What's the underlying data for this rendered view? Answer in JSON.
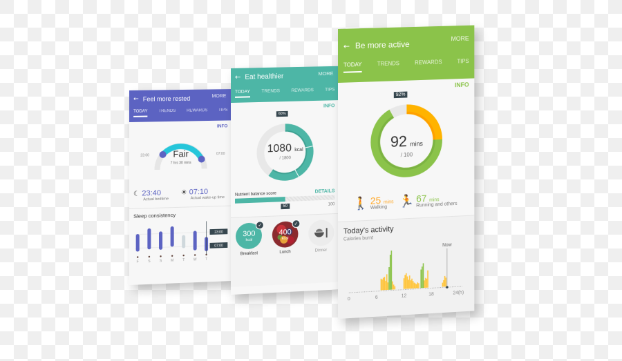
{
  "phones": {
    "sleep": {
      "title": "Feel more rested",
      "more": "MORE",
      "tabs": [
        "TODAY",
        "TRENDS",
        "REWARDS",
        "TIPS"
      ],
      "active_tab": "TODAY",
      "info": "INFO",
      "color": "#5c63c2",
      "gauge": {
        "rating": "Fair",
        "duration": "7 hrs 30 mins",
        "target_start": "23:00",
        "target_end": "07:00",
        "arc_color": "#26c6da"
      },
      "bedtime": {
        "value": "23:40",
        "label": "Actual bedtime",
        "icon": "moon-icon"
      },
      "wakeup": {
        "value": "07:10",
        "label": "Actual wake-up time",
        "icon": "sunrise-icon"
      },
      "consistency": {
        "title": "Sleep consistency",
        "days": [
          "F",
          "S",
          "S",
          "M",
          "T",
          "W",
          "T"
        ],
        "bars": [
          {
            "start": 0.25,
            "end": 0.92,
            "active": true
          },
          {
            "start": 0.05,
            "end": 0.85,
            "active": true
          },
          {
            "start": 0.18,
            "end": 0.88,
            "active": true
          },
          {
            "start": 0.0,
            "end": 0.78,
            "active": true
          },
          {
            "start": 0.35,
            "end": 0.85,
            "active": false
          },
          {
            "start": 0.2,
            "end": 0.95,
            "active": true
          },
          {
            "start": 0.45,
            "end": 1.0,
            "active": true
          }
        ],
        "ref_top": "23:00",
        "ref_bottom": "07:00"
      }
    },
    "eat": {
      "title": "Eat healthier",
      "more": "MORE",
      "tabs": [
        "TODAY",
        "TRENDS",
        "REWARDS",
        "TIPS"
      ],
      "active_tab": "TODAY",
      "info": "INFO",
      "color": "#4db6a6",
      "ring": {
        "percent_label": "60%",
        "progress": 0.6,
        "value": "1080",
        "unit": "kcal",
        "goal": "/ 1800"
      },
      "nutrient": {
        "label": "Nutrient balance score",
        "details": "DETAILS",
        "score": 50,
        "max": 100,
        "score_label": "50",
        "max_label": "100"
      },
      "meals": [
        {
          "name": "Breakfast",
          "value": "300",
          "unit": "kcal",
          "logged": true
        },
        {
          "name": "Lunch",
          "value": "400",
          "unit": "kcal",
          "logged": true
        },
        {
          "name": "Dinner",
          "value": "",
          "unit": "",
          "logged": false
        }
      ]
    },
    "active": {
      "title": "Be more active",
      "more": "MORE",
      "tabs": [
        "TODAY",
        "TRENDS",
        "REWARDS",
        "TIPS"
      ],
      "active_tab": "TODAY",
      "info": "INFO",
      "color": "#8bc34a",
      "ring": {
        "percent_label": "92%",
        "progress": 0.92,
        "value": "92",
        "unit": "mins",
        "goal": "/ 100",
        "walking_share": 0.25,
        "walking_color": "#ffb300",
        "running_color": "#8bc34a"
      },
      "walking": {
        "value": "25",
        "unit": "mins",
        "label": "Walking",
        "color": "#ffa726"
      },
      "running": {
        "value": "67",
        "unit": "mins",
        "label": "Running and others",
        "color": "#8bc34a"
      },
      "activity": {
        "title": "Today's activity",
        "subtitle": "Calories burnt",
        "now_label": "Now",
        "now_hour": 21.5
      }
    }
  },
  "chart_data": {
    "type": "bar",
    "title": "Today's activity",
    "subtitle": "Calories burnt",
    "xlabel": "",
    "ylabel": "",
    "xlim": [
      0,
      24
    ],
    "x_ticks": [
      "0",
      "6",
      "12",
      "18",
      "24(h)"
    ],
    "annotation": {
      "label": "Now",
      "x": 21.5
    },
    "series": [
      {
        "name": "Walking",
        "color": "#ffc53d",
        "x": [
          7.0,
          7.25,
          7.5,
          7.75,
          8.0,
          8.25,
          8.5,
          9.5,
          9.75,
          10.0,
          12.0,
          12.25,
          12.5,
          12.75,
          13.0,
          13.25,
          13.5,
          13.75,
          14.0,
          14.25,
          14.5,
          14.75,
          15.0,
          15.25,
          16.5,
          16.75,
          17.0,
          17.25,
          20.5,
          20.75,
          21.0,
          21.25
        ],
        "values": [
          0.28,
          0.26,
          0.3,
          0.32,
          0.22,
          0.38,
          0.18,
          0.2,
          0.12,
          0.08,
          0.26,
          0.34,
          0.38,
          0.3,
          0.22,
          0.32,
          0.2,
          0.24,
          0.18,
          0.14,
          0.12,
          0.1,
          0.14,
          0.12,
          0.18,
          0.24,
          0.22,
          0.42,
          0.1,
          0.16,
          0.26,
          0.22
        ]
      },
      {
        "name": "Running",
        "color": "#8bc34a",
        "x": [
          8.75,
          9.0,
          9.25,
          15.75,
          16.0,
          16.25
        ],
        "values": [
          0.55,
          0.85,
          0.95,
          0.45,
          0.52,
          0.6
        ]
      }
    ]
  }
}
